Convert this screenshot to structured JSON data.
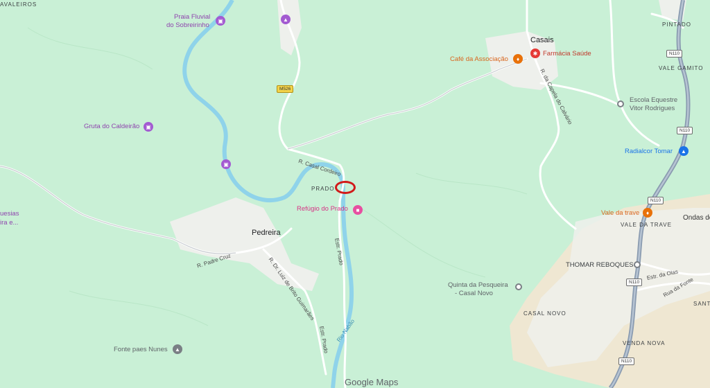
{
  "map": {
    "attribution": "Google Maps",
    "colors": {
      "land": "#c9f0d6",
      "river": "#8fd3ea",
      "road": "#ffffff",
      "highway": "#8a9bb0",
      "urban": "#eef0ec",
      "sand": "#efe7d2",
      "marker": "#d11a1a"
    }
  },
  "labels": {
    "vaqueiros": "AVALEIROS",
    "pintado": "PINTADO",
    "vale_gamito": "VALE GAMITO",
    "casais": "Casais",
    "prado": "PRADO",
    "pedreira": "Pedreira",
    "vale_da_trave": "VALE DA TRAVE",
    "casal_novo": "CASAL NOVO",
    "venda_nova": "VENDA NOVA",
    "ondas": "Ondas de",
    "sant": "SANT",
    "quesias_1": "uesias",
    "quesias_2": "ira e..."
  },
  "pois": {
    "praia_fluvial_1": "Praia Fluvial",
    "praia_fluvial_2": "do Sobreirinho",
    "gruta": "Gruta do Caldeirão",
    "cafe": "Café da Associação",
    "farmacia": "Farmácia Saúde",
    "escola_1": "Escola Equestre",
    "escola_2": "Vitor Rodrigues",
    "radialcor": "Radialcor Tomar",
    "vale_trave_poi": "Vale da trave",
    "thomar": "THOMAR REBOQUES",
    "quinta_1": "Quinta da Pesqueira",
    "quinta_2": "- Casal Novo",
    "fonte": "Fonte paes Nunes",
    "refugio": "Refúgio do Prado"
  },
  "streets": {
    "casal_cordeiro": "R. Casal Cordeiro",
    "capela": "R. da Capela do Calvário",
    "padre_cruz": "R. Padre Cruz",
    "brito": "R. Dr. Luiz de Brito Guimarães",
    "estr_prado_1": "Estr. Prado",
    "estr_prado_2": "Estr. Prado",
    "nabao": "Rio Nabão",
    "estr_olas": "Estr. da Olas",
    "rua_fonte": "Rua da Fonte"
  },
  "shields": {
    "m526": "M526",
    "n110_a": "N110",
    "n110_b": "N110",
    "n110_c": "N110",
    "n110_d": "N110",
    "n110_e": "N110"
  }
}
